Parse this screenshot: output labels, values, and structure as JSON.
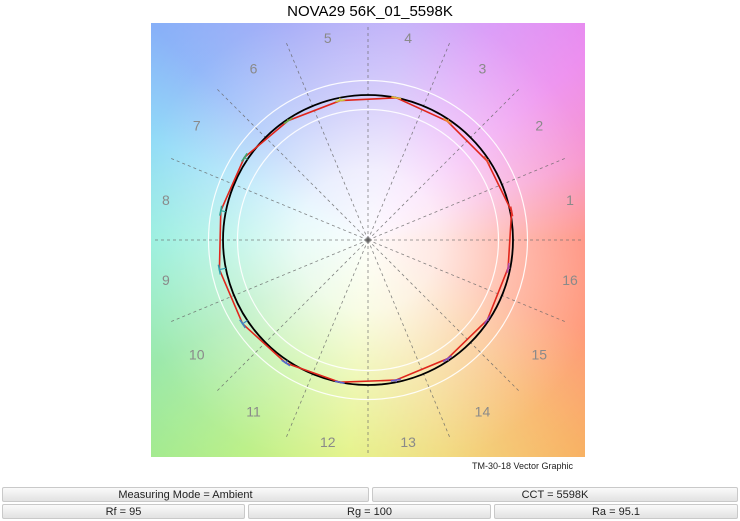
{
  "chart_data": {
    "type": "polar-vector",
    "title": "NOVA29 56K_01_5598K",
    "subtitle": "TM-30-18 Vector Graphic",
    "hue_bins": [
      "1",
      "2",
      "3",
      "4",
      "5",
      "6",
      "7",
      "8",
      "9",
      "10",
      "11",
      "12",
      "13",
      "14",
      "15",
      "16"
    ],
    "reference_radius": 1.0,
    "grid_rings": [
      0.9,
      1.0,
      1.1
    ],
    "series": [
      {
        "name": "",
        "color": "#e0261c",
        "test_radii": [
          1.01,
          0.985,
          0.985,
          1.0,
          0.98,
          0.99,
          1.025,
          1.035,
          1.045,
          1.04,
          1.02,
          1.0,
          0.985,
          0.985,
          0.99,
          0.985
        ]
      }
    ],
    "reference_color": "#000000"
  },
  "metrics": {
    "mode": "Measuring Mode = Ambient",
    "cct": "CCT = 5598K",
    "rf": "Rf = 95",
    "rg": "Rg = 100",
    "ra": "Ra = 95.1"
  },
  "colors": {
    "test_line": "#e0261c",
    "reference_circle": "#000000",
    "grid": "#ffffff",
    "spoke": "#666666"
  }
}
